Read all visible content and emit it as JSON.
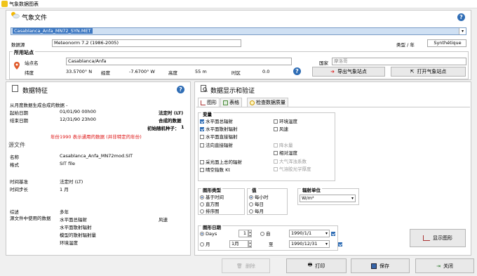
{
  "window": {
    "title": "气象数据图表"
  },
  "weather_file": {
    "title": "气象文件",
    "file": "Casablanca_Anfa_MN72_SYN.MET",
    "source_label": "数据源",
    "source_value": "Meteonorm 7.2 (1986-2005)",
    "type_label": "类型 / 年",
    "type_value": "Synthétique"
  },
  "site": {
    "title": "所用站点",
    "name_label": "站点名",
    "name_value": "Casablanca/Anfa",
    "country_label": "国家",
    "country_value": "摩洛哥",
    "lat_label": "纬度",
    "lat_value": "33.5700° N",
    "lon_label": "经度",
    "lon_value": "-7.6700° W",
    "alt_label": "高度",
    "alt_value": "55 m",
    "tz_label": "时区",
    "tz_value": "0.0",
    "export_button": "导出气象站点",
    "open_button": "打开气象站点"
  },
  "data_features": {
    "title": "数据特征",
    "line1": "从月度数据生成合成的数据 -",
    "start_label": "起始日期",
    "start_value": "01/01/90 00h00",
    "end_label": "结束日期",
    "end_value": "12/31/90 23h00",
    "legal_time": "法定时 (LT)",
    "synthetic_data": "合成的数据",
    "init_rng": "初始随机种子：",
    "init_rng_value": "1",
    "warning": "年份1990 表示通用的数据 (并非特定的年份)"
  },
  "source_file": {
    "title": "源文件",
    "name_label": "名称",
    "name_value": "Casablanca_Anfa_MN72mod.SIT",
    "format_label": "格式",
    "format_value": "SIT file",
    "timebase_label": "时间基准",
    "timebase_value": "法定时 (LT)",
    "timestep_label": "时间步长",
    "timestep_value": "1 月",
    "summary_label": "综述",
    "summary_value": "多年",
    "vars_label": "源文件中使用的数据",
    "vars": [
      "水平面总辐射",
      "水平面散射辐射",
      "模型的散射辐射量",
      "环境温度"
    ],
    "vars_extra": "风速"
  },
  "display": {
    "title": "数据显示和验证",
    "tabs": [
      "图形",
      "表格",
      "检查数据质量"
    ],
    "variables_title": "变量",
    "variables": [
      {
        "label": "水平面总辐射",
        "checked": true,
        "disabled": false
      },
      {
        "label": "水平面散射辐射",
        "checked": true,
        "disabled": false
      },
      {
        "label": "水平面直接辐射",
        "checked": false,
        "disabled": false
      },
      {
        "label": "法向直接辐射",
        "checked": false,
        "disabled": false
      },
      {
        "label": "采光面上总的辐射",
        "checked": false,
        "disabled": false
      },
      {
        "label": "晴空指数 Kt",
        "checked": false,
        "disabled": false
      }
    ],
    "variables_right": [
      {
        "label": "环境温度",
        "checked": false,
        "disabled": false
      },
      {
        "label": "风速",
        "checked": false,
        "disabled": false
      },
      {
        "label": "降水量",
        "checked": false,
        "disabled": true
      },
      {
        "label": "相对湿度",
        "checked": false,
        "disabled": false
      },
      {
        "label": "大气浑浊系数",
        "checked": false,
        "disabled": true
      },
      {
        "label": "气溶胶光学厚度",
        "checked": false,
        "disabled": true
      }
    ],
    "graph_type_title": "图形类型",
    "graph_types": [
      "基于时间",
      "直方图",
      "排序图"
    ],
    "value_title": "值",
    "values": [
      "每小时",
      "每日",
      "每月"
    ],
    "unit_title": "辐射单位",
    "unit_value": "W/m²",
    "dates_title": "图形日期",
    "days_label": "Days",
    "days_value": "1",
    "month_label": "月",
    "month_value": "1月",
    "from_label": "自",
    "from_value": "1990/1/1",
    "to_label": "至",
    "to_value": "1990/12/31",
    "show_button": "显示图形"
  },
  "footer": {
    "delete": "删除",
    "print": "打印",
    "save": "保存",
    "close": "关闭"
  }
}
